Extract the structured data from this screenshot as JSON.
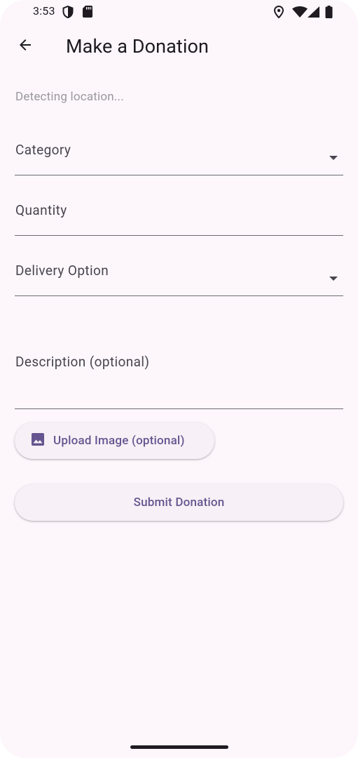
{
  "status_bar": {
    "time": "3:53",
    "icons_left": [
      "shield-icon",
      "sd-card-icon"
    ],
    "icons_right": [
      "location-pin-icon",
      "wifi-icon",
      "signal-icon",
      "battery-icon"
    ]
  },
  "app_bar": {
    "back_icon": "arrow-back-icon",
    "title": "Make a Donation"
  },
  "location_status": "Detecting location...",
  "form": {
    "category_label": "Category",
    "quantity_label": "Quantity",
    "delivery_label": "Delivery Option",
    "description_label": "Description (optional)"
  },
  "buttons": {
    "upload_label": "Upload Image (optional)",
    "upload_icon": "image-icon",
    "submit_label": "Submit Donation"
  },
  "colors": {
    "background": "#fdf7fc",
    "accent": "#66558f",
    "button_bg": "#f7f1f7"
  }
}
